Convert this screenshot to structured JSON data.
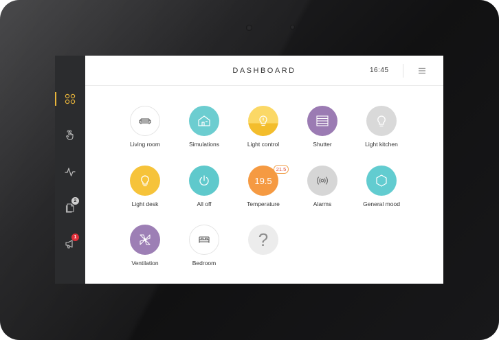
{
  "header": {
    "title": "DASHBOARD",
    "time": "16:45"
  },
  "sidebar": {
    "items": [
      {
        "icon": "grid-icon",
        "active": true
      },
      {
        "icon": "hand-touch-icon"
      },
      {
        "icon": "pulse-icon"
      },
      {
        "icon": "document-icon",
        "badge": "2"
      },
      {
        "icon": "megaphone-icon",
        "badge": "1"
      }
    ],
    "accent": "#e9b53b",
    "alert_color": "#e0303a"
  },
  "tiles": [
    {
      "label": "Living room",
      "icon": "sofa-icon",
      "color": "#ffffff"
    },
    {
      "label": "Simulations",
      "icon": "house-icon",
      "color": "#6ccdd0"
    },
    {
      "label": "Light control",
      "icon": "light-dimmer-icon",
      "color": "#f8cb46"
    },
    {
      "label": "Shutter",
      "icon": "shutter-icon",
      "color": "#9b7bb3"
    },
    {
      "label": "Light kitchen",
      "icon": "bulb-icon",
      "color": "#d9d9d9"
    },
    {
      "label": "Light desk",
      "icon": "bulb-icon",
      "color": "#f6c33a"
    },
    {
      "label": "All off",
      "icon": "power-icon",
      "color": "#5fc9cc"
    },
    {
      "label": "Temperature",
      "value": "19.5",
      "setpoint": "21.5",
      "color": "#f59a42"
    },
    {
      "label": "Alarms",
      "icon": "alarm-signal-icon",
      "color": "#d6d6d6"
    },
    {
      "label": "General mood",
      "icon": "hexagon-icon",
      "color": "#62ccd0"
    },
    {
      "label": "Ventilation",
      "icon": "ventilation-icon",
      "color": "#9d7fb5"
    },
    {
      "label": "Bedroom",
      "icon": "bed-icon",
      "color": "#ffffff"
    },
    {
      "label": "",
      "icon": "question-icon",
      "symbol": "?",
      "color": "#ececec"
    }
  ]
}
